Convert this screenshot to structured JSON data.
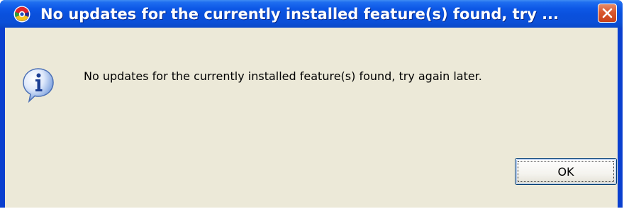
{
  "dialog": {
    "title": "No updates for the currently installed feature(s) found, try ...",
    "message": "No updates for the currently installed feature(s) found, try again later.",
    "ok_label": "OK",
    "icons": {
      "app": "eclipse-app-icon",
      "info": "information-icon",
      "close": "close-icon"
    }
  },
  "colors": {
    "titlebar": "#0a50dc",
    "client": "#ece9d8",
    "close_button": "#d9572e",
    "button_border": "#003c74"
  }
}
